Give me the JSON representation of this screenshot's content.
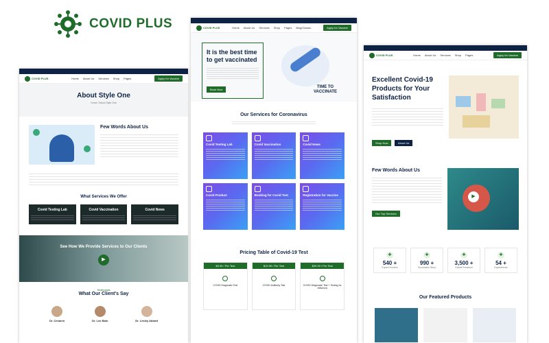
{
  "brand": {
    "name": "COVID PLUS"
  },
  "left": {
    "title": "About Style One",
    "breadcrumb": "Home / About Style One",
    "few_words": "Few Words About Us",
    "services_heading": "What Services We Offer",
    "cards": [
      {
        "title": "Covid Testing Lab"
      },
      {
        "title": "Covid Vaccination"
      },
      {
        "title": "Covid News"
      }
    ],
    "video_heading": "See How We Provide Services to Our Clients",
    "testimonials_kicker": "Testimonials",
    "testimonials_heading": "What Our Client's Say",
    "doctors": [
      "Dr. Cesaren",
      "Dr. Leo Bain",
      "Dr. Lesley Abbott"
    ]
  },
  "center": {
    "hero_title": "It is the best time to get vaccinated",
    "hero_button": "Book Now",
    "vaccinate_text": "TIME TO VACCINATE",
    "services_heading": "Our Services for Coronavirus",
    "services": [
      {
        "title": "Covid Testing Lab"
      },
      {
        "title": "Covid Vaccination"
      },
      {
        "title": "Covid News"
      },
      {
        "title": "Covid Product"
      },
      {
        "title": "Booking for Covid Test"
      },
      {
        "title": "Registration for Vaccine"
      }
    ],
    "pricing_heading": "Pricing Table of Covid-19 Test",
    "prices": [
      {
        "price": "$9.99 / Per Test",
        "name": "COVID Diagnostic Test"
      },
      {
        "price": "$19.99 / Per Test",
        "name": "COVID Antibody Test"
      },
      {
        "price": "$29.99 / Per Test",
        "name": "COVID Diagnostic Test + Testing for Influenza"
      }
    ]
  },
  "right": {
    "hero_title": "Excellent Covid-19 Products for Your Satisfaction",
    "btn_shop": "Shop Now",
    "btn_about": "About Us",
    "few_words": "Few Words About Us",
    "cta": "Our Top Services",
    "stats": [
      {
        "value": "540 +",
        "label": "Expert Doctors"
      },
      {
        "value": "990 +",
        "label": "Successful Story"
      },
      {
        "value": "3,500 +",
        "label": "Global Presence"
      },
      {
        "value": "54 +",
        "label": "Experiences"
      }
    ],
    "featured_heading": "Our Featured Products"
  },
  "nav": {
    "cta": "Apply for Vaccine",
    "items": [
      "Home",
      "About Us",
      "Services",
      "Shop",
      "Pages",
      "Blog/Classic",
      "Contact"
    ]
  },
  "colors": {
    "green": "#1f6b2a",
    "navy": "#0e2344",
    "purple": "#7b4de8",
    "blue": "#3aa0f5"
  }
}
